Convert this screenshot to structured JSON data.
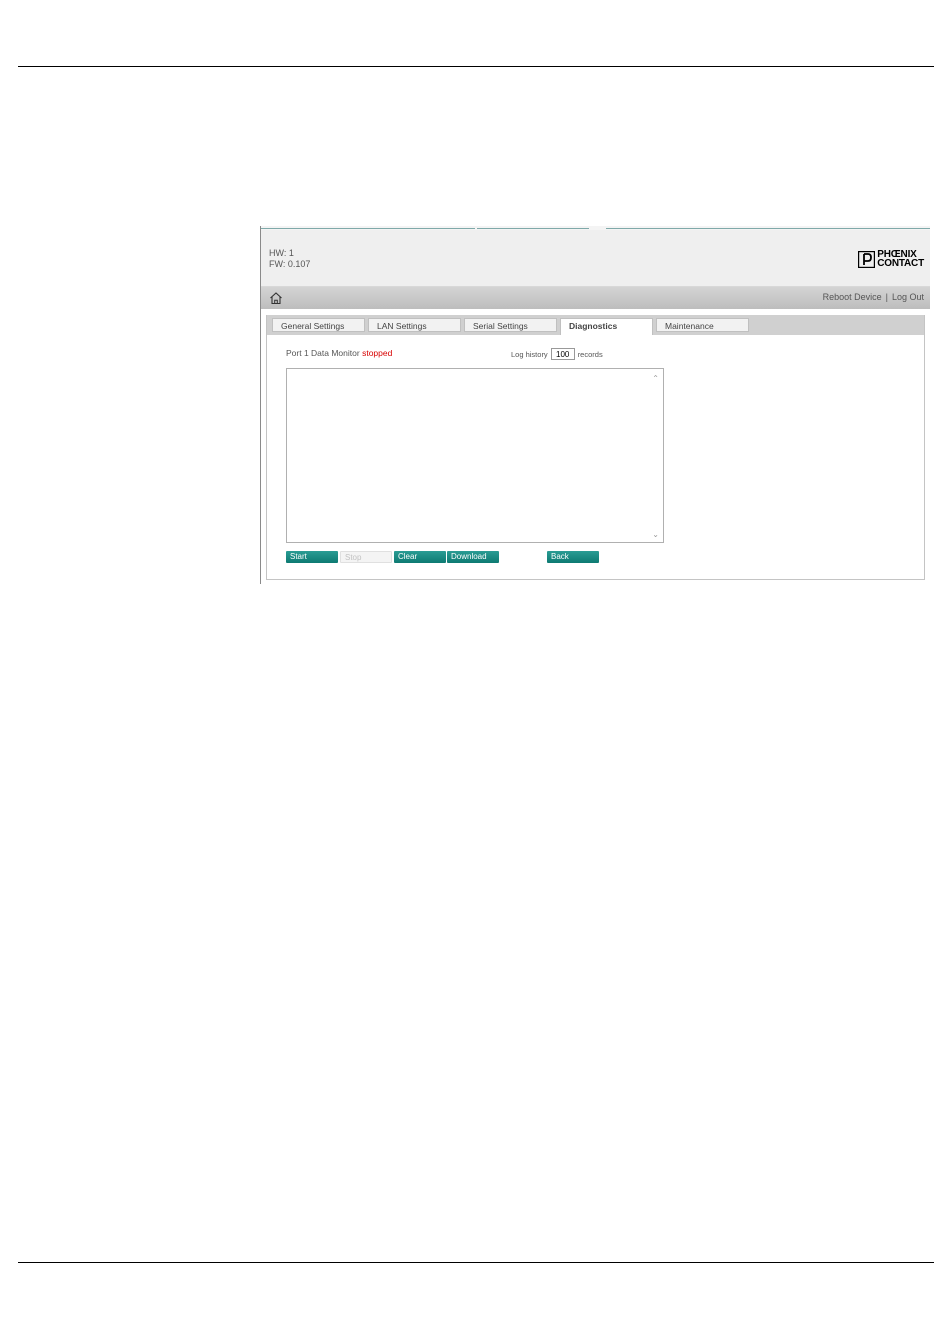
{
  "device": {
    "hw": "HW: 1",
    "fw": "FW: 0.107"
  },
  "logo": {
    "line1": "PHŒNIX",
    "line2": "CONTACT"
  },
  "nav": {
    "reboot": "Reboot Device",
    "separator": "|",
    "logout": "Log Out"
  },
  "tabs": [
    {
      "label": "General Settings",
      "active": false
    },
    {
      "label": "LAN Settings",
      "active": false
    },
    {
      "label": "Serial Settings",
      "active": false
    },
    {
      "label": "Diagnostics",
      "active": true
    },
    {
      "label": "Maintenance",
      "active": false
    }
  ],
  "monitor": {
    "label": "Port 1 Data Monitor",
    "status": "stopped"
  },
  "log_history": {
    "prefix": "Log history",
    "value": "100",
    "suffix": "records"
  },
  "icons": {
    "home": "home-icon",
    "scroll_up": "chevron-up-icon",
    "scroll_down": "chevron-down-icon",
    "logo": "phoenix-contact-logo-icon"
  },
  "buttons": {
    "start": "Start",
    "stop": "Stop",
    "clear": "Clear",
    "download": "Download",
    "back": "Back"
  },
  "colors": {
    "accent": "#0d7a72",
    "status_stopped": "#d80000"
  }
}
